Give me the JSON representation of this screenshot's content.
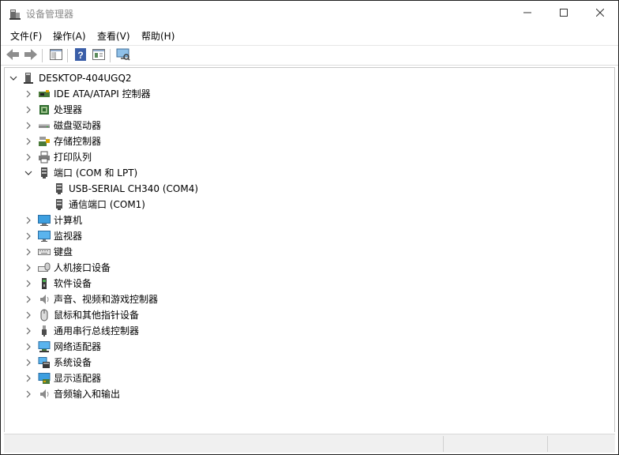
{
  "window": {
    "title": "设备管理器",
    "controls": {
      "minimize": "minimize-icon",
      "maximize": "maximize-icon",
      "close": "close-icon"
    }
  },
  "menu": [
    {
      "label": "文件(F)"
    },
    {
      "label": "操作(A)"
    },
    {
      "label": "查看(V)"
    },
    {
      "label": "帮助(H)"
    }
  ],
  "toolbar": [
    {
      "name": "back-button",
      "icon": "arrow-left-icon"
    },
    {
      "name": "forward-button",
      "icon": "arrow-right-icon"
    },
    {
      "name": "show-hide-console-tree-button",
      "icon": "console-tree-icon"
    },
    {
      "name": "help-button",
      "icon": "help-icon"
    },
    {
      "name": "properties-button",
      "icon": "properties-icon"
    },
    {
      "name": "scan-hardware-button",
      "icon": "monitor-scan-icon"
    }
  ],
  "tree": {
    "root": {
      "label": "DESKTOP-404UGQ2",
      "expanded": true,
      "icon": "computer-tower-icon"
    },
    "items": [
      {
        "label": "IDE ATA/ATAPI 控制器",
        "icon": "ide-controller-icon",
        "expanded": false
      },
      {
        "label": "处理器",
        "icon": "processor-icon",
        "expanded": false
      },
      {
        "label": "磁盘驱动器",
        "icon": "disk-drive-icon",
        "expanded": false
      },
      {
        "label": "存储控制器",
        "icon": "storage-controller-icon",
        "expanded": false
      },
      {
        "label": "打印队列",
        "icon": "printer-icon",
        "expanded": false
      },
      {
        "label": "端口 (COM 和 LPT)",
        "icon": "port-icon",
        "expanded": true,
        "children": [
          {
            "label": "USB-SERIAL CH340 (COM4)",
            "icon": "port-icon"
          },
          {
            "label": "通信端口 (COM1)",
            "icon": "port-icon"
          }
        ]
      },
      {
        "label": "计算机",
        "icon": "computer-icon",
        "expanded": false
      },
      {
        "label": "监视器",
        "icon": "monitor-icon",
        "expanded": false
      },
      {
        "label": "键盘",
        "icon": "keyboard-icon",
        "expanded": false
      },
      {
        "label": "人机接口设备",
        "icon": "hid-icon",
        "expanded": false
      },
      {
        "label": "软件设备",
        "icon": "software-device-icon",
        "expanded": false
      },
      {
        "label": "声音、视频和游戏控制器",
        "icon": "speaker-icon",
        "expanded": false
      },
      {
        "label": "鼠标和其他指针设备",
        "icon": "mouse-icon",
        "expanded": false
      },
      {
        "label": "通用串行总线控制器",
        "icon": "usb-icon",
        "expanded": false
      },
      {
        "label": "网络适配器",
        "icon": "network-adapter-icon",
        "expanded": false
      },
      {
        "label": "系统设备",
        "icon": "system-device-icon",
        "expanded": false
      },
      {
        "label": "显示适配器",
        "icon": "display-adapter-icon",
        "expanded": false
      },
      {
        "label": "音频输入和输出",
        "icon": "audio-io-icon",
        "expanded": false
      }
    ]
  },
  "colors": {
    "title_text": "#8a8a8a",
    "border": "#1f1f1f",
    "status_bg": "#f0f0f0"
  }
}
